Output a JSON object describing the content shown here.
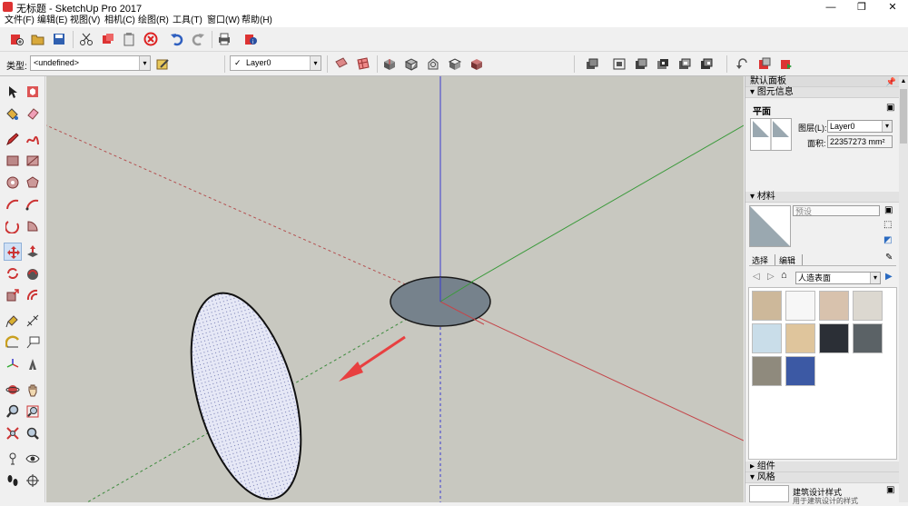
{
  "window": {
    "title": "无标题 - SketchUp Pro 2017",
    "minimize": "—",
    "restore": "❐",
    "close": "✕"
  },
  "menu": [
    "文件(F)",
    "编辑(E)",
    "视图(V)",
    "相机(C)",
    "绘图(R)",
    "工具(T)",
    "窗口(W)",
    "帮助(H)"
  ],
  "toolbar2": {
    "type_label": "类型:",
    "type_value": "<undefined>",
    "layer_check": "✓",
    "layer_value": "Layer0"
  },
  "panel": {
    "title": "默认面板",
    "entity_info": {
      "header": "图元信息",
      "entity_type": "平面",
      "layer_label": "图层(L):",
      "layer_value": "Layer0",
      "area_label": "面积:",
      "area_value": "22357273 mm²"
    },
    "materials": {
      "header": "材料",
      "material_name": "预设",
      "tab_select": "选择",
      "tab_edit": "编辑",
      "library": "人造表面",
      "swatch_colors": [
        "#cdb89a",
        "#f7f7f7",
        "#d8c2ad",
        "#dcd8d0",
        "#c9dde9",
        "#dfc59c",
        "#2b2f36",
        "#5b6266",
        "#8f8a7d",
        "#3c59a4"
      ]
    },
    "components_header": "组件",
    "styles": {
      "header": "风格",
      "style_name": "建筑设计样式",
      "sub_label": "用于建筑设计的样式"
    }
  },
  "colors": {
    "viewport": "#c8c8c0",
    "axis_red": "#c4464a",
    "axis_green": "#3a9a3a",
    "axis_blue": "#3b3bd0",
    "arrow": "#e84040"
  }
}
